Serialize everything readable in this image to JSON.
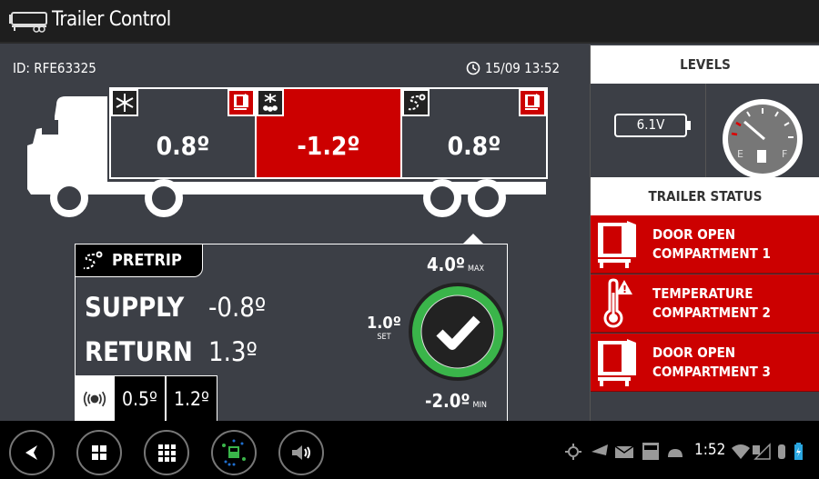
{
  "header": {
    "title": "Trailer Control",
    "icon": "trailer-icon"
  },
  "main": {
    "trailer_id": "ID: RFE63325",
    "datetime": "15/09 13:52",
    "compartments": [
      {
        "temp": "0.8º",
        "mode_icon": "snowflake-icon",
        "door_open": true,
        "alert": false
      },
      {
        "temp": "-1.2º",
        "mode_icon": "defrost-icon",
        "door_open": false,
        "alert": true
      },
      {
        "temp": "0.8º",
        "mode_icon": "pretrip-route-icon",
        "door_open": true,
        "alert": false
      }
    ],
    "detail": {
      "mode": "PRETRIP",
      "supply_label": "SUPPLY",
      "supply_value": "-0.8º",
      "return_label": "RETURN",
      "return_value": "1.3º",
      "sensor_values": [
        "0.5º",
        "1.2º"
      ],
      "max_value": "4.0º",
      "max_label": "MAX",
      "min_value": "-2.0º",
      "min_label": "MIN",
      "set_value": "1.0º",
      "set_label": "SET",
      "status": "ok"
    }
  },
  "levels": {
    "title": "LEVELS",
    "battery": "6.1V",
    "fuel_empty_label": "E",
    "fuel_full_label": "F"
  },
  "trailer_status": {
    "title": "TRAILER STATUS",
    "items": [
      {
        "line1": "DOOR OPEN",
        "line2": "COMPARTMENT 1",
        "icon": "door-open-icon"
      },
      {
        "line1": "TEMPERATURE",
        "line2": "COMPARTMENT 2",
        "icon": "thermometer-warning-icon"
      },
      {
        "line1": "DOOR OPEN",
        "line2": "COMPARTMENT 3",
        "icon": "door-open-icon"
      }
    ]
  },
  "system_bar": {
    "nav_buttons": [
      "back",
      "home",
      "apps",
      "trailer-app",
      "volume"
    ],
    "clock": "1:52"
  },
  "colors": {
    "alert": "#cc0000",
    "ok": "#3ab54a",
    "background": "#3c3f46"
  }
}
